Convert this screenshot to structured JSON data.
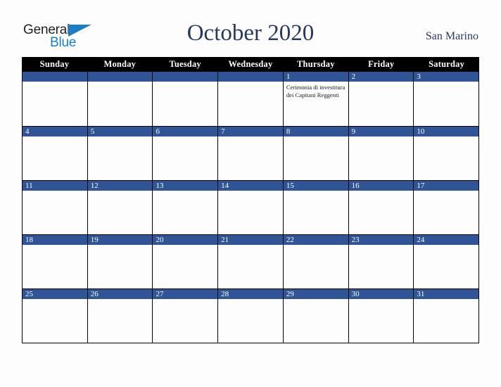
{
  "brand": {
    "name_part1": "General",
    "name_part2": "Blue",
    "triangle_color": "#1b7ec2",
    "text_color": "#231f20"
  },
  "header": {
    "title": "October 2020",
    "subtitle": "San Marino",
    "title_color": "#27395c"
  },
  "calendar": {
    "month": "October",
    "year": "2020",
    "region": "San Marino",
    "header_bg": "#000000",
    "date_strip_bg": "#2f5596",
    "grid_border": "#000000",
    "day_names": [
      "Sunday",
      "Monday",
      "Tuesday",
      "Wednesday",
      "Thursday",
      "Friday",
      "Saturday"
    ],
    "weeks": [
      [
        {
          "date": "",
          "events": []
        },
        {
          "date": "",
          "events": []
        },
        {
          "date": "",
          "events": []
        },
        {
          "date": "",
          "events": []
        },
        {
          "date": "1",
          "events": [
            "Cerimonia di investitura dei Capitani Reggenti"
          ]
        },
        {
          "date": "2",
          "events": []
        },
        {
          "date": "3",
          "events": []
        }
      ],
      [
        {
          "date": "4",
          "events": []
        },
        {
          "date": "5",
          "events": []
        },
        {
          "date": "6",
          "events": []
        },
        {
          "date": "7",
          "events": []
        },
        {
          "date": "8",
          "events": []
        },
        {
          "date": "9",
          "events": []
        },
        {
          "date": "10",
          "events": []
        }
      ],
      [
        {
          "date": "11",
          "events": []
        },
        {
          "date": "12",
          "events": []
        },
        {
          "date": "13",
          "events": []
        },
        {
          "date": "14",
          "events": []
        },
        {
          "date": "15",
          "events": []
        },
        {
          "date": "16",
          "events": []
        },
        {
          "date": "17",
          "events": []
        }
      ],
      [
        {
          "date": "18",
          "events": []
        },
        {
          "date": "19",
          "events": []
        },
        {
          "date": "20",
          "events": []
        },
        {
          "date": "21",
          "events": []
        },
        {
          "date": "22",
          "events": []
        },
        {
          "date": "23",
          "events": []
        },
        {
          "date": "24",
          "events": []
        }
      ],
      [
        {
          "date": "25",
          "events": []
        },
        {
          "date": "26",
          "events": []
        },
        {
          "date": "27",
          "events": []
        },
        {
          "date": "28",
          "events": []
        },
        {
          "date": "29",
          "events": []
        },
        {
          "date": "30",
          "events": []
        },
        {
          "date": "31",
          "events": []
        }
      ]
    ]
  }
}
